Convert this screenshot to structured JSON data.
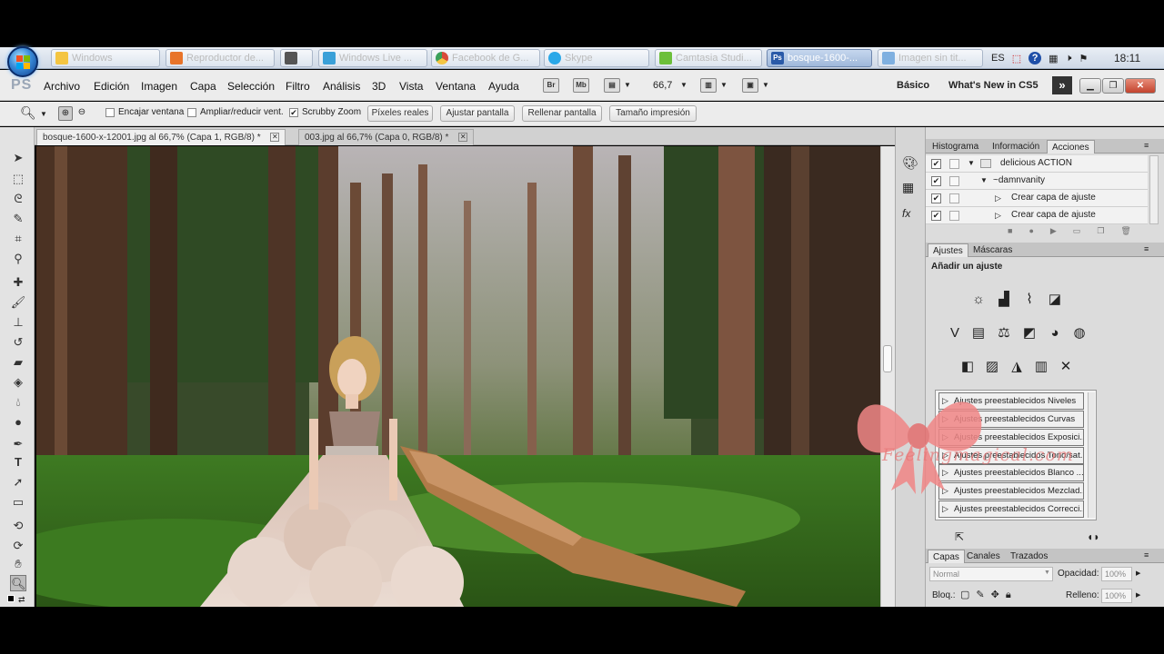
{
  "taskbar": {
    "buttons": [
      {
        "label": "Windows",
        "active": false,
        "icon_color": "#f4c542"
      },
      {
        "label": "Reproductor de...",
        "active": false,
        "icon_color": "#e8742a"
      },
      {
        "label": "",
        "active": false,
        "icon_color": "#555555"
      },
      {
        "label": "Windows Live ...",
        "active": false,
        "icon_color": "#3aa0d8"
      },
      {
        "label": "Facebook de G...",
        "active": false,
        "icon_color": "#d84b3a"
      },
      {
        "label": "Skype",
        "active": false,
        "icon_color": "#2aa8e8"
      },
      {
        "label": "Camtasia Studi...",
        "active": false,
        "icon_color": "#6cbf3a"
      },
      {
        "label": "bosque-1600-...",
        "active": true,
        "icon_color": "#2a5aa8"
      },
      {
        "label": "Imagen sin tit...",
        "active": false,
        "icon_color": "#7fb0e0"
      }
    ],
    "language": "ES",
    "clock": "18:11"
  },
  "menubar": {
    "logo": "PS",
    "items": [
      "Archivo",
      "Edición",
      "Imagen",
      "Capa",
      "Selección",
      "Filtro",
      "Análisis",
      "3D",
      "Vista",
      "Ventana",
      "Ayuda"
    ],
    "tool_buttons": [
      "Br",
      "Mb"
    ],
    "zoom": "66,7",
    "workspace": "Básico",
    "whats_new": "What's New in CS5",
    "more": "»"
  },
  "options": {
    "checks": [
      {
        "label": "Encajar ventana",
        "checked": false
      },
      {
        "label": "Ampliar/reducir vent.",
        "checked": false
      },
      {
        "label": "Scrubby Zoom",
        "checked": true
      }
    ],
    "buttons": [
      "Píxeles reales",
      "Ajustar pantalla",
      "Rellenar pantalla",
      "Tamaño impresión"
    ]
  },
  "documents": {
    "tabs": [
      {
        "label": "bosque-1600-x-12001.jpg al 66,7% (Capa 1, RGB/8) *",
        "active": true
      },
      {
        "label": "003.jpg al 66,7% (Capa 0, RGB/8) *",
        "active": false
      }
    ]
  },
  "panels": {
    "top_tabs": [
      "Histograma",
      "Información",
      "Acciones"
    ],
    "top_active": "Acciones",
    "actions": [
      {
        "label": "delicious ACTION",
        "indent": 0
      },
      {
        "label": "~damnvanity",
        "indent": 1
      },
      {
        "label": "Crear capa de ajuste",
        "indent": 2
      },
      {
        "label": "Crear capa de ajuste",
        "indent": 2
      }
    ],
    "adjust_tabs": [
      "Ajustes",
      "Máscaras"
    ],
    "adjust_title": "Añadir un ajuste",
    "presets": [
      "Ajustes preestablecidos Niveles",
      "Ajustes preestablecidos Curvas",
      "Ajustes preestablecidos Exposici...",
      "Ajustes preestablecidos Tono/sat...",
      "Ajustes preestablecidos Blanco ...",
      "Ajustes preestablecidos Mezclad...",
      "Ajustes preestablecidos Correcci..."
    ],
    "layer_tabs": [
      "Capas",
      "Canales",
      "Trazados"
    ],
    "blend_mode": "Normal",
    "opacity_label": "Opacidad:",
    "opacity_value": "100%",
    "lock_label": "Bloq.:",
    "fill_label": "Relleno:",
    "fill_value": "100%"
  },
  "watermark": {
    "text": "Feelingmagical.com",
    "color": "#f07a7a"
  }
}
